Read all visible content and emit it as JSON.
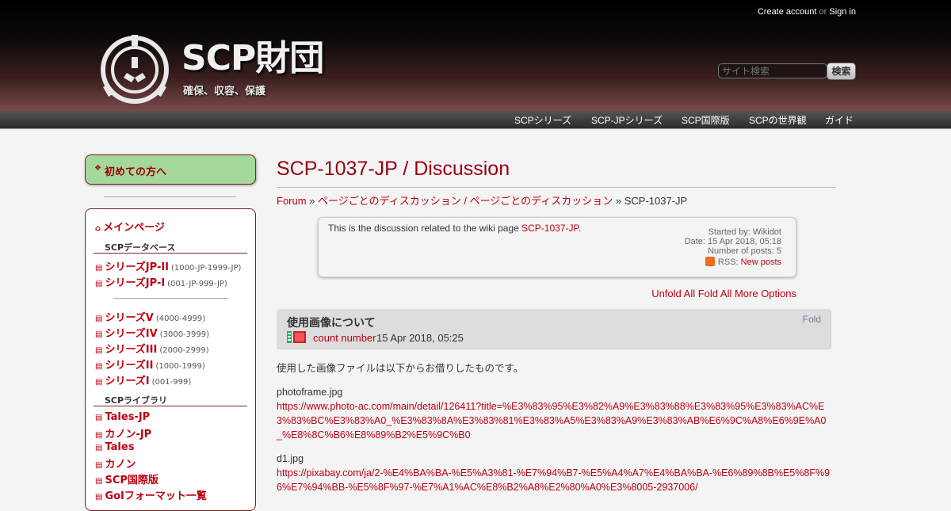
{
  "header": {
    "account": {
      "create": "Create account",
      "or": "or",
      "signin": "Sign in"
    },
    "site_title": "SCP財団",
    "site_subtitle": "確保、収容、保護",
    "search": {
      "placeholder": "サイト検索",
      "button": "検索"
    }
  },
  "nav": [
    "SCPシリーズ",
    "SCP-JPシリーズ",
    "SCP国際版",
    "SCPの世界観",
    "ガイド"
  ],
  "sidebar": {
    "first_box": "初めての方へ",
    "main_page": "メインページ",
    "database_head": "SCPデータベース",
    "jp_series": [
      {
        "label": "シリーズJP-II",
        "range": "(1000-JP-1999-JP)"
      },
      {
        "label": "シリーズJP-I",
        "range": "(001-JP-999-JP)"
      }
    ],
    "series": [
      {
        "label": "シリーズV",
        "range": "(4000-4999)"
      },
      {
        "label": "シリーズIV",
        "range": "(3000-3999)"
      },
      {
        "label": "シリーズIII",
        "range": "(2000-2999)"
      },
      {
        "label": "シリーズII",
        "range": "(1000-1999)"
      },
      {
        "label": "シリーズI",
        "range": "(001-999)"
      }
    ],
    "library_head": "SCPライブラリ",
    "library": [
      "Tales-JP",
      "カノン-JP",
      "Tales",
      "カノン",
      "SCP国際版",
      "GoIフォーマット一覧"
    ]
  },
  "main": {
    "title": "SCP-1037-JP / Discussion",
    "breadcrumb": {
      "forum": "Forum",
      "sep1": " » ",
      "category": "ページごとのディスカッション / ページごとのディスカッション",
      "sep2": " » ",
      "current": "SCP-1037-JP"
    },
    "info": {
      "desc": "This is the discussion related to the wiki page",
      "page_link": "SCP-1037-JP",
      "period": ".",
      "started_by": "Started by: Wikidot",
      "date": "Date: 15 Apr 2018, 05:18",
      "posts": "Number of posts: 5",
      "rss_label": "RSS:",
      "rss_link": "New posts"
    },
    "thread_options": "Unfold All Fold All More Options",
    "post": {
      "title": "使用画像について",
      "fold": "Fold",
      "author": "count number",
      "date": "15 Apr 2018, 05:25",
      "intro": "使用した画像ファイルは以下からお借りしたものです。",
      "file1": "photoframe.jpg",
      "url1": "https://www.photo-ac.com/main/detail/126411?title=%E3%83%95%E3%82%A9%E3%83%88%E3%83%95%E3%83%AC%E3%83%BC%E3%83%A0_%E3%83%8A%E3%83%81%E3%83%A5%E3%83%A9%E3%83%AB%E6%9C%A8%E6%9E%A0_%E8%8C%B6%E8%89%B2%E5%9C%B0",
      "file2": "d1.jpg",
      "url2": "https://pixabay.com/ja/2-%E4%BA%BA-%E5%A3%81-%E7%94%B7-%E5%A4%A7%E4%BA%BA-%E6%89%8B%E5%8F%96%E7%94%BB-%E5%8F%97-%E7%A1%AC%E8%B2%A8%E2%80%A0%E3%8005-2937006/"
    }
  }
}
